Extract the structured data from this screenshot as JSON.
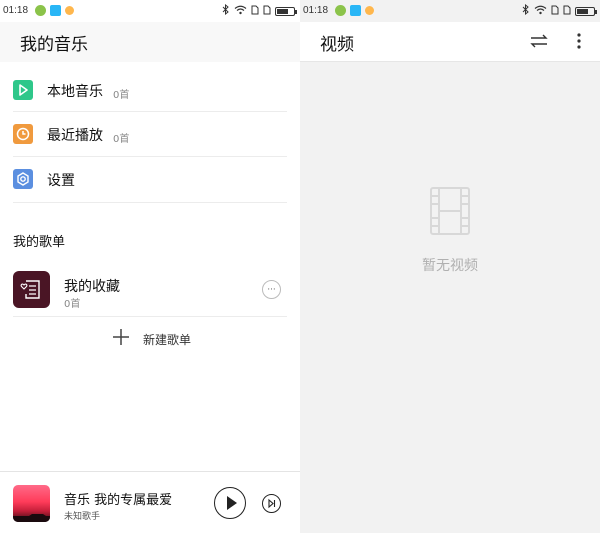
{
  "left_status": {
    "time": "01:18"
  },
  "right_status": {
    "time": "01:18"
  },
  "battery": {
    "level": 0.65
  },
  "left_header": {
    "title": "我的音乐"
  },
  "library": {
    "items": [
      {
        "label": "本地音乐",
        "count": "0首",
        "icon": "play-icon",
        "color": "#2ec78a"
      },
      {
        "label": "最近播放",
        "count": "0首",
        "icon": "clock-icon",
        "color": "#f09a3e"
      },
      {
        "label": "设置",
        "icon": "settings-icon",
        "color": "#5b8fe0"
      }
    ]
  },
  "playlists": {
    "title": "我的歌单",
    "items": [
      {
        "name": "我的收藏",
        "count": "0首",
        "icon": "heart-list-icon"
      }
    ],
    "more_label": "···",
    "new_label": "新建歌单"
  },
  "player": {
    "song": "音乐 我的专属最爱",
    "artist": "未知歌手"
  },
  "right_header": {
    "title": "视频"
  },
  "video": {
    "empty_text": "暂无视频"
  }
}
